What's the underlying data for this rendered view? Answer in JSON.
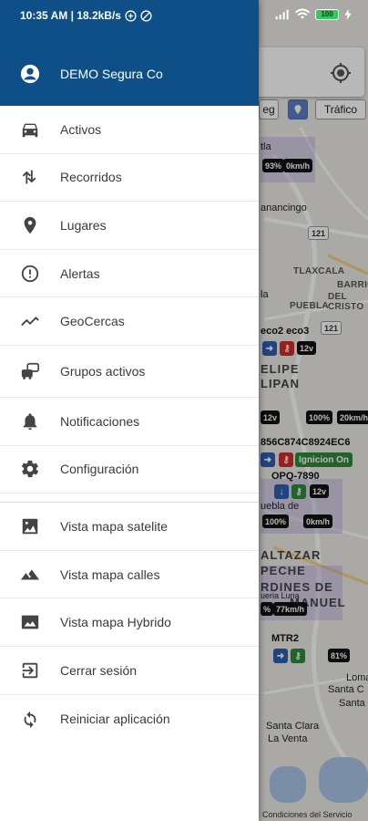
{
  "status_bar": {
    "time_and_speed": "10:35 AM | 18.2kB/s",
    "battery_level": "100"
  },
  "header": {
    "company_name": "DEMO Segura Co",
    "background_color": "#0d4f86"
  },
  "menu": {
    "primary_items": [
      {
        "label": "Activos",
        "icon": "car-icon"
      },
      {
        "label": "Recorridos",
        "icon": "route-icon"
      },
      {
        "label": "Lugares",
        "icon": "place-pin-icon"
      },
      {
        "label": "Alertas",
        "icon": "alert-icon"
      },
      {
        "label": "GeoCercas",
        "icon": "trending-line-icon"
      },
      {
        "label": "Grupos activos",
        "icon": "vehicle-group-icon"
      },
      {
        "label": "Notificaciones",
        "icon": "bell-icon"
      },
      {
        "label": "Configuración",
        "icon": "gear-icon"
      }
    ],
    "secondary_items": [
      {
        "label": "Vista mapa satelite",
        "icon": "satellite-image-icon"
      },
      {
        "label": "Vista mapa calles",
        "icon": "terrain-icon"
      },
      {
        "label": "Vista mapa Hybrido",
        "icon": "hybrid-image-icon"
      },
      {
        "label": "Cerrar sesión",
        "icon": "logout-icon"
      },
      {
        "label": "Reiniciar aplicación",
        "icon": "restart-icon"
      }
    ]
  },
  "map": {
    "traffic_button": "Tráfico",
    "partial_button": "eg",
    "footer": "Condiciones del Servicio",
    "labels": {
      "tlaxcala": "TLAXCALA",
      "barrio": "BARRIO",
      "del_cristo": "DEL CRISTO",
      "puebla": "PUEBLA",
      "ancingo": "anancingo",
      "route_121_a": "121",
      "route_121_b": "121",
      "felipe": "ELIPE",
      "lipan": "LIPAN",
      "altazar": "ALTAZAR",
      "peche": "PECHE",
      "rdines_de": "RDINES DE",
      "manuel": "MANUEL",
      "loma": "Loma",
      "santa_c": "Santa C",
      "santa": "Santa",
      "santa_clara": "Santa Clara",
      "la_venta": "La Venta",
      "tla": "tla",
      "la": "la",
      "uebla": "uebla de",
      "ueria_luna": "ueria Luna"
    },
    "chips": {
      "pct93": "93%",
      "kmh0a": "0km/h",
      "eco": "eco2 eco3",
      "v12a": "12v",
      "v12b": "12v",
      "v12c": "12v",
      "pct100a": "100%",
      "kmh20": "20km/h",
      "plate_long": "856C874C8924EC6",
      "ignicion": "Ignicion On",
      "opq": "OPQ-7890",
      "pct100b": "100%",
      "kmh0b": "0km/h",
      "pct_partial": "%",
      "kmh77": "77km/h",
      "mtr2": "MTR2",
      "pct81": "81%"
    }
  }
}
